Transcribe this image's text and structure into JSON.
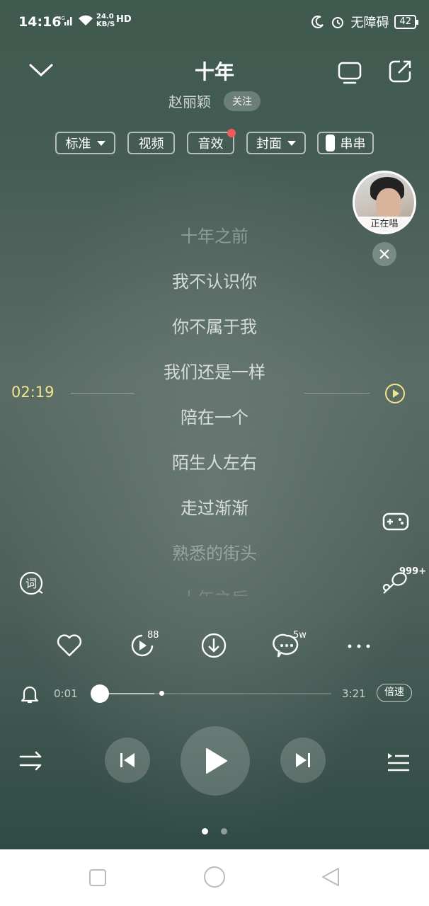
{
  "status_bar": {
    "time": "14:16",
    "network": "4G",
    "speed_value": "24.0",
    "speed_unit": "KB/S",
    "hd": "HD",
    "accessibility": "无障碍",
    "battery": "42"
  },
  "song": {
    "title": "十年",
    "artist": "赵丽颖",
    "follow_label": "关注"
  },
  "chips": [
    {
      "label": "标准",
      "has_dropdown": true
    },
    {
      "label": "视频"
    },
    {
      "label": "音效",
      "has_dot": true
    },
    {
      "label": "封面",
      "has_dropdown": true
    },
    {
      "label": "串串",
      "has_toggle": true
    }
  ],
  "singer_overlay": {
    "label": "正在唱"
  },
  "lyrics": [
    {
      "text": "十年之前",
      "style": "dim"
    },
    {
      "text": "我不认识你",
      "style": "normal"
    },
    {
      "text": "你不属于我",
      "style": "normal"
    },
    {
      "text": "我们还是一样",
      "style": "normal"
    },
    {
      "text": "陪在一个",
      "style": "normal"
    },
    {
      "text": "陌生人左右",
      "style": "normal"
    },
    {
      "text": "走过渐渐",
      "style": "normal"
    },
    {
      "text": "熟悉的街头",
      "style": "dim"
    },
    {
      "text": "十年之后",
      "style": "fade"
    }
  ],
  "seek_indicator": {
    "time": "02:19"
  },
  "side": {
    "lyric_label": "词",
    "spotlight_badge": "999+"
  },
  "actions": {
    "mv_badge": "88",
    "comment_badge": "5w"
  },
  "progress": {
    "current": "0:01",
    "total": "3:21",
    "speed_label": "倍速",
    "fraction": 0.005
  },
  "pager": {
    "count": 2,
    "active": 0
  },
  "colors": {
    "seek_time": "#f1e58a",
    "red_dot": "#f25a5a"
  }
}
